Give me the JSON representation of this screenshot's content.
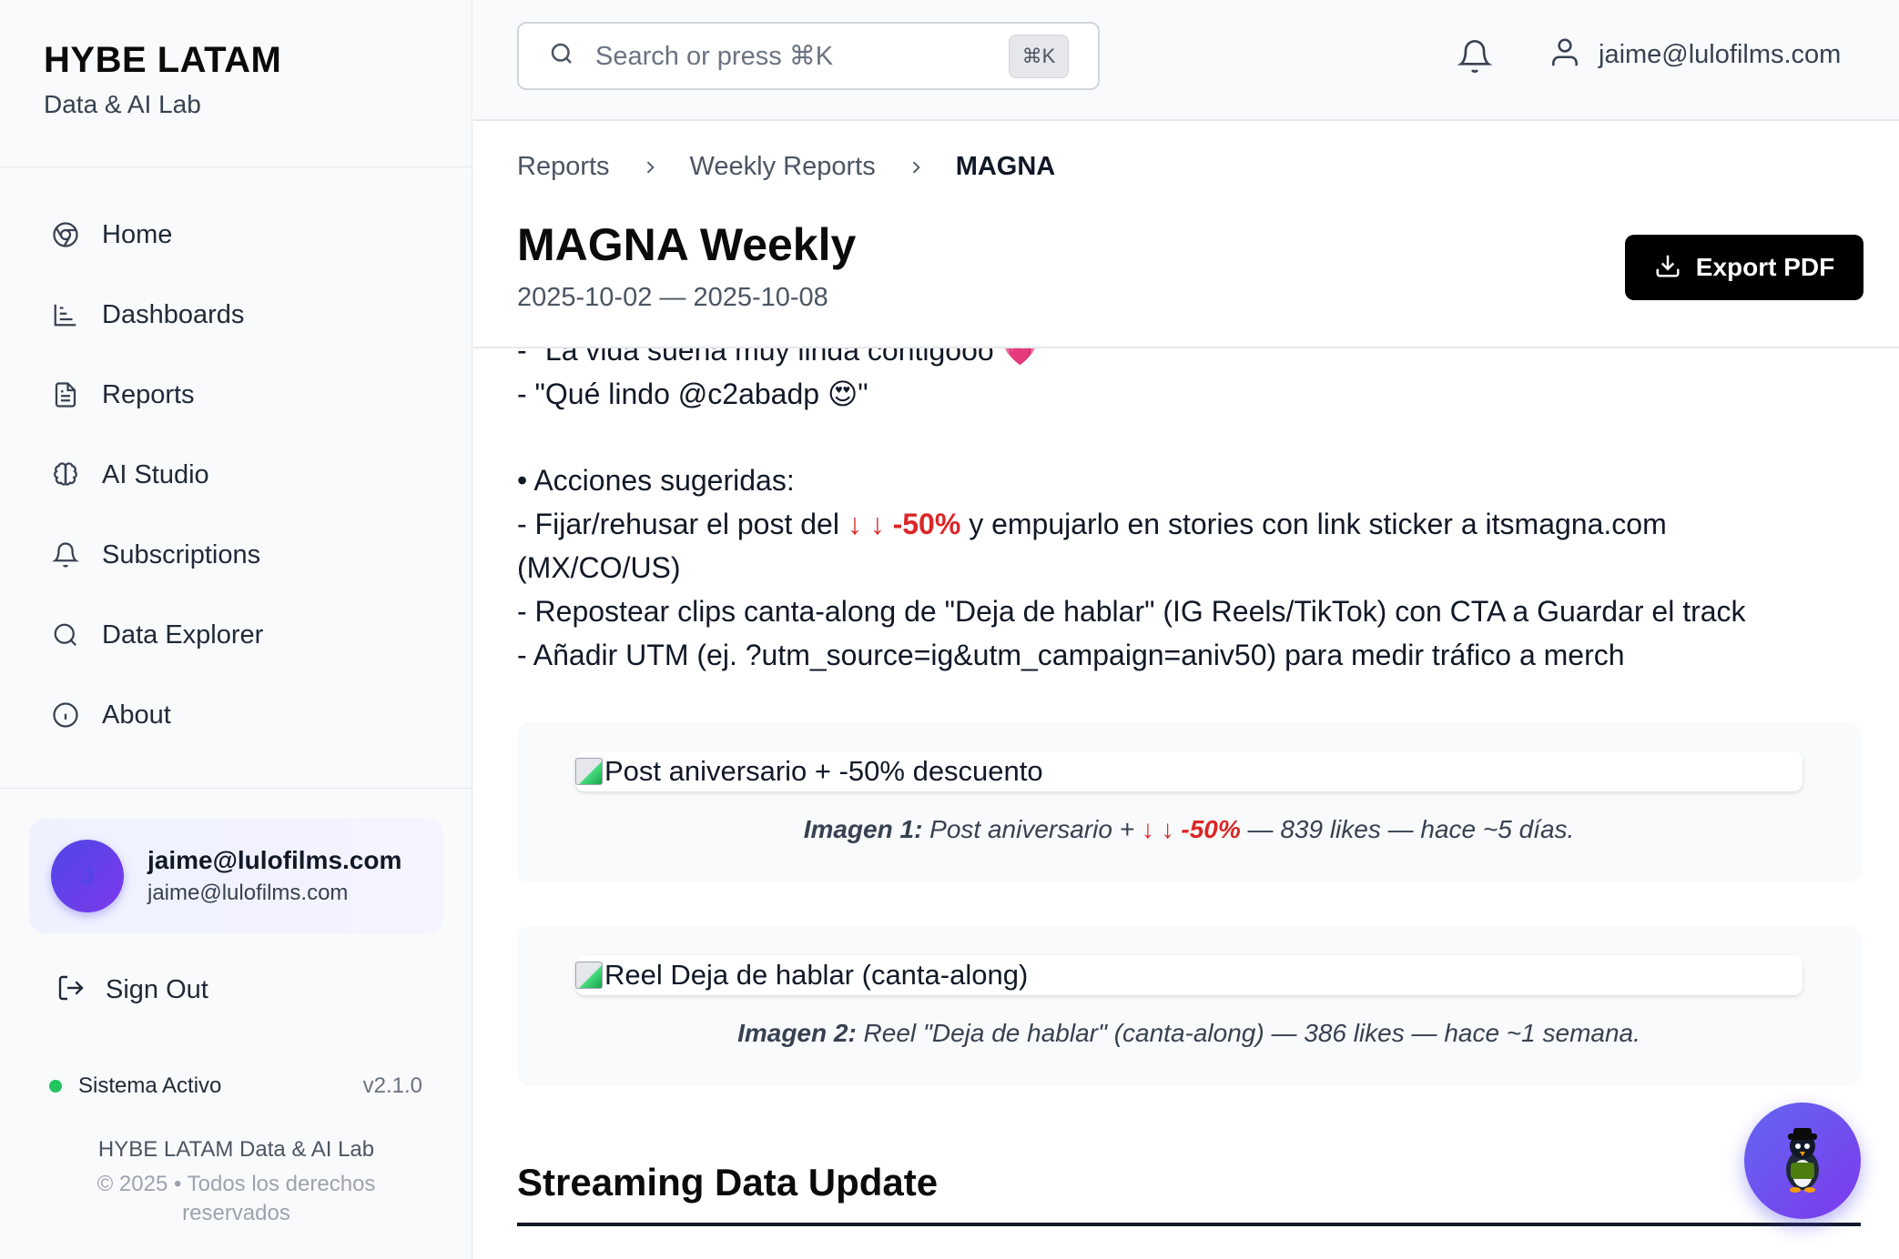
{
  "brand": {
    "title": "HYBE LATAM",
    "subtitle": "Data & AI Lab"
  },
  "nav": [
    {
      "label": "Home",
      "icon": "chrome-icon"
    },
    {
      "label": "Dashboards",
      "icon": "bar-chart-icon"
    },
    {
      "label": "Reports",
      "icon": "file-text-icon"
    },
    {
      "label": "AI Studio",
      "icon": "brain-icon"
    },
    {
      "label": "Subscriptions",
      "icon": "bell-icon"
    },
    {
      "label": "Data Explorer",
      "icon": "search-icon"
    },
    {
      "label": "About",
      "icon": "info-icon"
    }
  ],
  "user": {
    "initial": "J",
    "name": "jaime@lulofilms.com",
    "email": "jaime@lulofilms.com"
  },
  "signout": {
    "label": "Sign Out"
  },
  "status": {
    "label": "Sistema Activo",
    "version": "v2.1.0",
    "color": "#22c55e"
  },
  "footer": {
    "line1": "HYBE LATAM Data & AI Lab",
    "line2": "© 2025 • Todos los derechos reservados"
  },
  "topbar": {
    "search_placeholder": "Search or press ⌘K",
    "shortcut": "⌘K",
    "user_email": "jaime@lulofilms.com"
  },
  "breadcrumb": {
    "items": [
      "Reports",
      "Weekly Reports"
    ],
    "current": "MAGNA"
  },
  "page": {
    "title": "MAGNA Weekly",
    "date_range": "2025-10-02 — 2025-10-08",
    "export_label": "Export PDF"
  },
  "content": {
    "quote1": "- \"La vida suena muy linda contigooo 💗",
    "quote2": "- \"Qué lindo @c2abadp 😍\"",
    "actions_heading": "• Acciones sugeridas:",
    "action1_pre": "- Fijar/rehusar el post del ",
    "discount": "-50%",
    "action1_post": " y empujarlo en stories con link sticker a itsmagna.com",
    "action1_cont": "(MX/CO/US)",
    "action2": "- Repostear clips canta-along de \"Deja de hablar\" (IG Reels/TikTok) con CTA a Guardar el track",
    "action3": "- Añadir UTM (ej. ?utm_source=ig&utm_campaign=aniv50) para medir tráfico a merch"
  },
  "images": [
    {
      "alt": "Post aniversario + -50% descuento",
      "caption_label": "Imagen 1:",
      "caption_pre": " Post aniversario + ",
      "caption_discount": "-50%",
      "caption_post": " — 839 likes — hace ~5 días."
    },
    {
      "alt": "Reel Deja de hablar (canta-along)",
      "caption_label": "Imagen 2:",
      "caption_text": " Reel \"Deja de hablar\" (canta-along) — 386 likes — hace ~1 semana."
    }
  ],
  "section": {
    "title": "Streaming Data Update"
  },
  "colors": {
    "accent_red": "#dc2626",
    "brand_purple": "#6366f1",
    "status_green": "#22c55e"
  }
}
